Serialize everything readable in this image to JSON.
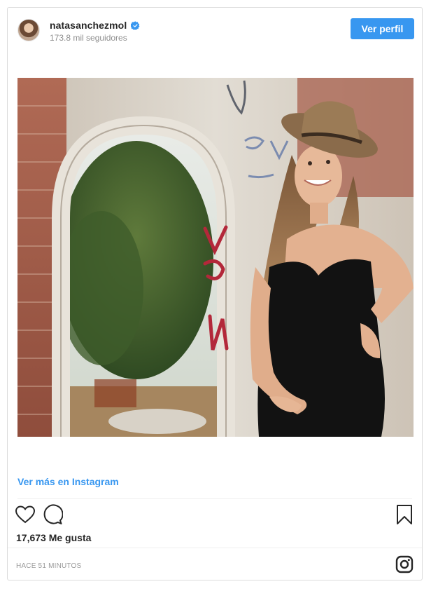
{
  "post": {
    "username": "natasanchezmol",
    "followers": "173.8 mil seguidores",
    "view_profile_label": "Ver perfil",
    "view_more_label": "Ver más en Instagram",
    "likes": "17,673 Me gusta",
    "timestamp": "HACE 51 MINUTOS"
  },
  "icons": {
    "verified": "verified-badge-icon",
    "like": "heart-icon",
    "comment": "comment-icon",
    "save": "bookmark-icon",
    "brand": "instagram-icon"
  },
  "colors": {
    "accent": "#3897f0",
    "text": "#262626",
    "muted": "#8e8e8e",
    "border": "#dbdbdb"
  }
}
